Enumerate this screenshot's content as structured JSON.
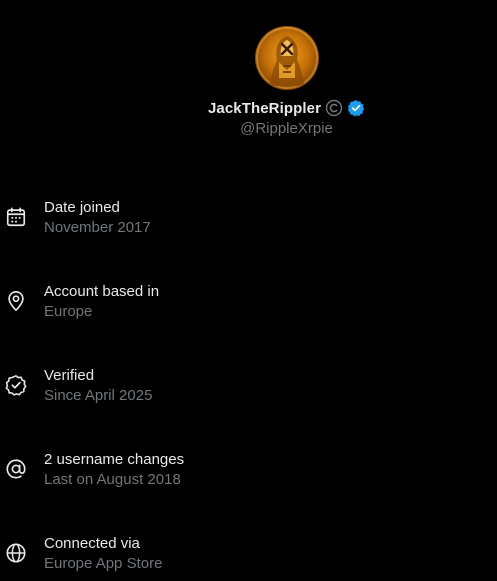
{
  "profile": {
    "display_name": "JackTheRippler",
    "handle": "@RippleXrpie",
    "avatar_icon": "golden-figure-avatar",
    "badges": [
      "affiliate-badge-icon",
      "verified-badge-icon"
    ],
    "verified_color": "#1d9bf0"
  },
  "info": {
    "items": [
      {
        "icon": "calendar-icon",
        "title": "Date joined",
        "value": "November 2017"
      },
      {
        "icon": "location-pin-icon",
        "title": "Account based in",
        "value": "Europe"
      },
      {
        "icon": "verified-check-icon",
        "title": "Verified",
        "value": "Since April 2025"
      },
      {
        "icon": "at-sign-icon",
        "title": "2 username changes",
        "value": "Last on August 2018"
      },
      {
        "icon": "globe-icon",
        "title": "Connected via",
        "value": "Europe App Store"
      }
    ]
  },
  "colors": {
    "background": "#000000",
    "primary_text": "#e7e9ea",
    "secondary_text": "#71767b"
  }
}
